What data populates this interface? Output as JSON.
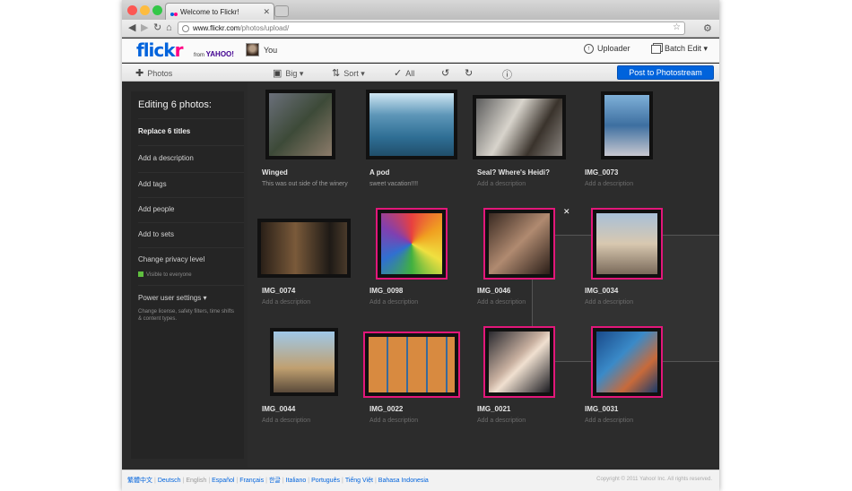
{
  "browser": {
    "tab_title": "Welcome to Flickr!",
    "url_host": "www.flickr.com",
    "url_path": "/photos/upload/"
  },
  "header": {
    "logo_a": "flick",
    "logo_b": "r",
    "from_text": "from",
    "yahoo_text": "YAHOO!",
    "user_name": "You",
    "uploader_label": "Uploader",
    "batch_edit_label": "Batch Edit ▾"
  },
  "toolbar": {
    "photos_label": "Photos",
    "size_label": "Big ▾",
    "sort_label": "Sort ▾",
    "all_label": "All",
    "post_button": "Post to Photostream"
  },
  "sidebar": {
    "title": "Editing 6 photos:",
    "items": [
      "Replace 6 titles",
      "Add a description",
      "Add tags",
      "Add people",
      "Add to sets",
      "Change privacy level",
      "Power user settings ▾"
    ],
    "privacy_sub": "Visible to everyone",
    "power_sub": "Change license, safety filters, time shifts & content types."
  },
  "photos": [
    {
      "title": "Winged",
      "description": "This was out side of the winery",
      "selected": false
    },
    {
      "title": "A pod",
      "description": "sweet vacation!!!!",
      "selected": false
    },
    {
      "title": "Seal? Where's Heidi?",
      "description": "Add a description",
      "selected": false
    },
    {
      "title": "IMG_0073",
      "description": "Add a description",
      "selected": false
    },
    {
      "title": "IMG_0074",
      "description": "Add a description",
      "selected": false
    },
    {
      "title": "IMG_0098",
      "description": "Add a description",
      "selected": true
    },
    {
      "title": "IMG_0046",
      "description": "Add a description",
      "selected": true
    },
    {
      "title": "IMG_0034",
      "description": "Add a description",
      "selected": true
    },
    {
      "title": "IMG_0044",
      "description": "Add a description",
      "selected": false
    },
    {
      "title": "IMG_0022",
      "description": "Add a description",
      "selected": true
    },
    {
      "title": "IMG_0021",
      "description": "Add a description",
      "selected": true
    },
    {
      "title": "IMG_0031",
      "description": "Add a description",
      "selected": true
    }
  ],
  "footer": {
    "languages": [
      "繁體中文",
      "Deutsch",
      "English",
      "Español",
      "Français",
      "한글",
      "Italiano",
      "Português",
      "Tiếng Việt",
      "Bahasa Indonesia"
    ],
    "current_language": "English",
    "copyright": "Copyright © 2011 Yahoo! Inc. All rights reserved."
  },
  "colors": {
    "brand_blue": "#0063dc",
    "brand_pink": "#ff0084",
    "selection": "#e2177a"
  }
}
